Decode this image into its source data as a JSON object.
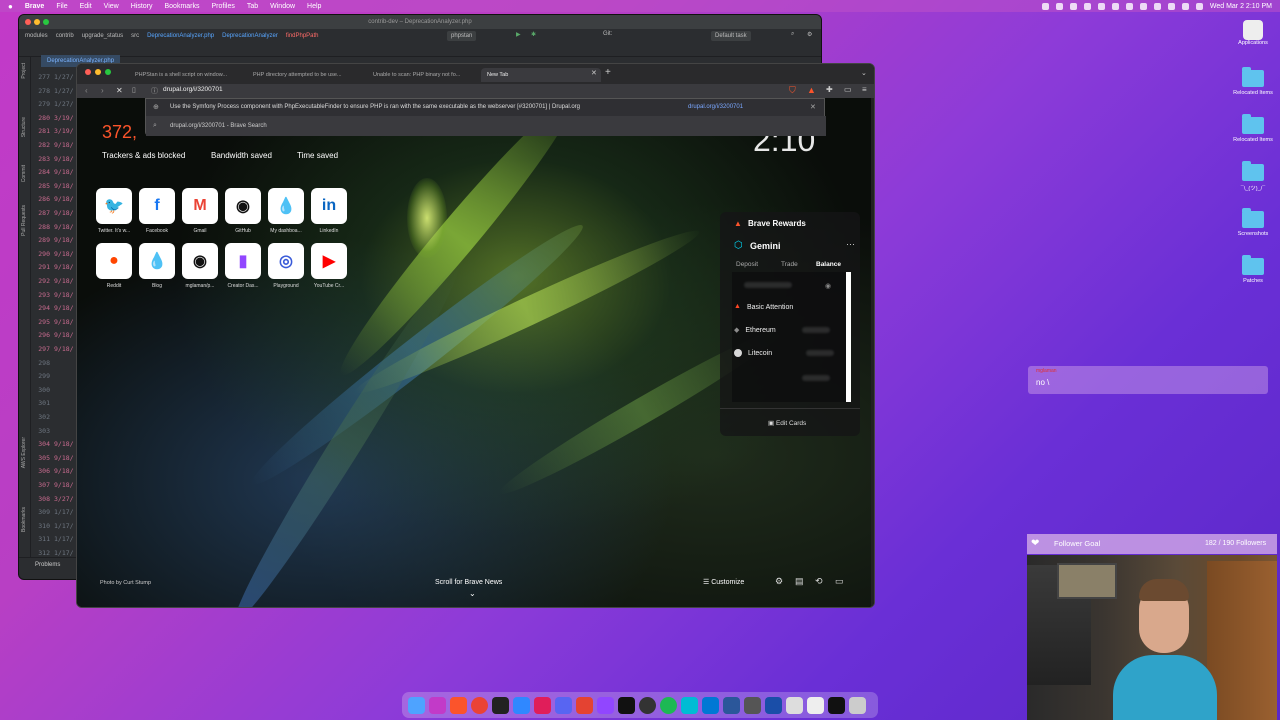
{
  "menubar": {
    "app": "Brave",
    "items": [
      "File",
      "Edit",
      "View",
      "History",
      "Bookmarks",
      "Profiles",
      "Tab",
      "Window",
      "Help"
    ],
    "clock": "Wed Mar 2  2:10 PM"
  },
  "desktop_icons": [
    {
      "label": "Applications"
    },
    {
      "label": "Relocated Items"
    },
    {
      "label": "Relocated Items"
    },
    {
      "label": "¯\\_(ツ)_/¯"
    },
    {
      "label": "Screenshots"
    },
    {
      "label": "Patches"
    }
  ],
  "ide": {
    "title": "contrib-dev – DeprecationAnalyzer.php",
    "breadcrumbs": [
      "modules",
      "contrib",
      "upgrade_status",
      "src",
      "DeprecationAnalyzer.php",
      "DeprecationAnalyzer",
      "findPhpPath"
    ],
    "run_config": "phpstan",
    "git_label": "Git:",
    "task": "Default task",
    "open_tab": "DeprecationAnalyzer.php",
    "side_labels": [
      "Project",
      "Structure",
      "Commit",
      "Pull Requests",
      "AWS Explorer",
      "Bookmarks"
    ],
    "bottom_tab": "Problems",
    "gutter": [
      {
        "n": "277",
        "d": "1/27/"
      },
      {
        "n": "278",
        "d": "1/27/"
      },
      {
        "n": "279",
        "d": "1/27/"
      },
      {
        "n": "280",
        "d": "3/19/"
      },
      {
        "n": "281",
        "d": "3/19/"
      },
      {
        "n": "282",
        "d": "9/18/"
      },
      {
        "n": "283",
        "d": "9/18/"
      },
      {
        "n": "284",
        "d": "9/18/"
      },
      {
        "n": "285",
        "d": "9/18/"
      },
      {
        "n": "286",
        "d": "9/18/"
      },
      {
        "n": "287",
        "d": "9/18/"
      },
      {
        "n": "288",
        "d": "9/18/"
      },
      {
        "n": "289",
        "d": "9/18/"
      },
      {
        "n": "290",
        "d": "9/18/"
      },
      {
        "n": "291",
        "d": "9/18/"
      },
      {
        "n": "292",
        "d": "9/18/"
      },
      {
        "n": "293",
        "d": "9/18/"
      },
      {
        "n": "294",
        "d": "9/18/"
      },
      {
        "n": "295",
        "d": "9/18/"
      },
      {
        "n": "296",
        "d": "9/18/"
      },
      {
        "n": "297",
        "d": "9/18/"
      },
      {
        "n": "298",
        "d": ""
      },
      {
        "n": "299",
        "d": ""
      },
      {
        "n": "300",
        "d": ""
      },
      {
        "n": "301",
        "d": ""
      },
      {
        "n": "302",
        "d": ""
      },
      {
        "n": "303",
        "d": ""
      },
      {
        "n": "304",
        "d": "9/18/"
      },
      {
        "n": "305",
        "d": "9/18/"
      },
      {
        "n": "306",
        "d": "9/18/"
      },
      {
        "n": "307",
        "d": "9/18/"
      },
      {
        "n": "308",
        "d": "3/27/"
      },
      {
        "n": "309",
        "d": "1/17/"
      },
      {
        "n": "310",
        "d": "1/17/"
      },
      {
        "n": "311",
        "d": "1/17/"
      },
      {
        "n": "312",
        "d": "1/17/"
      }
    ]
  },
  "browser": {
    "tabs": [
      "PHPStan is a shell script on window...",
      "PHP directory attempted to be use...",
      "Unable to scan: PHP binary not fo...",
      "New Tab"
    ],
    "url": "drupal.org/i/3200701",
    "suggestion_primary": "Use the Symfony Process component with PhpExecutableFinder to ensure PHP is ran with the same executable as the webserver [#3200701] | Drupal.org",
    "suggestion_primary_url": "drupal.org/i/3200701",
    "suggestion_search": "drupal.org/i/3200701 - Brave Search",
    "ntp": {
      "stat_value": "372,",
      "clock": "2:10",
      "stats": [
        "Trackers & ads blocked",
        "Bandwidth saved",
        "Time saved"
      ],
      "tiles": [
        {
          "label": "Twitter. It's w...",
          "glyph": "🐦",
          "color": "#1d9bf0"
        },
        {
          "label": "Facebook",
          "glyph": "f",
          "color": "#1877f2"
        },
        {
          "label": "Gmail",
          "glyph": "M",
          "color": "#ea4335"
        },
        {
          "label": "GitHub",
          "glyph": "◉",
          "color": "#111"
        },
        {
          "label": "My dashboa...",
          "glyph": "💧",
          "color": "#0d8ad8"
        },
        {
          "label": "LinkedIn",
          "glyph": "in",
          "color": "#0a66c2"
        },
        {
          "label": "Reddit",
          "glyph": "●",
          "color": "#ff4500"
        },
        {
          "label": "Blog",
          "glyph": "💧",
          "color": "#0d8ad8"
        },
        {
          "label": "mglaman/p...",
          "glyph": "◉",
          "color": "#111"
        },
        {
          "label": "Creator Das...",
          "glyph": "▮",
          "color": "#9146ff"
        },
        {
          "label": "Playground",
          "glyph": "◎",
          "color": "#3a5bd9"
        },
        {
          "label": "YouTube Cr...",
          "glyph": "▶",
          "color": "#ff0000"
        }
      ],
      "rewards_title": "Brave Rewards",
      "widget_title": "Gemini",
      "widget_tabs": [
        "Deposit",
        "Trade",
        "Balance"
      ],
      "coins": [
        {
          "name": "Basic Attention",
          "color": "#ff4724"
        },
        {
          "name": "Ethereum",
          "color": "#8c8c8c"
        },
        {
          "name": "Litecoin",
          "color": "#d8d8d8"
        }
      ],
      "edit_cards": "Edit Cards",
      "photo_credit": "Photo by Curt Stump",
      "scroll_news": "Scroll for Brave News",
      "customize": "Customize"
    }
  },
  "overlay": {
    "chat_user": "mglaman",
    "chat_text": "no \\",
    "follower_goal_label": "Follower Goal",
    "follower_goal_count": "182 / 190 Followers"
  },
  "colors": {
    "brave_accent": "#fb542b",
    "ide_bg": "#2b2d30",
    "desktop": "#b83fc4"
  }
}
